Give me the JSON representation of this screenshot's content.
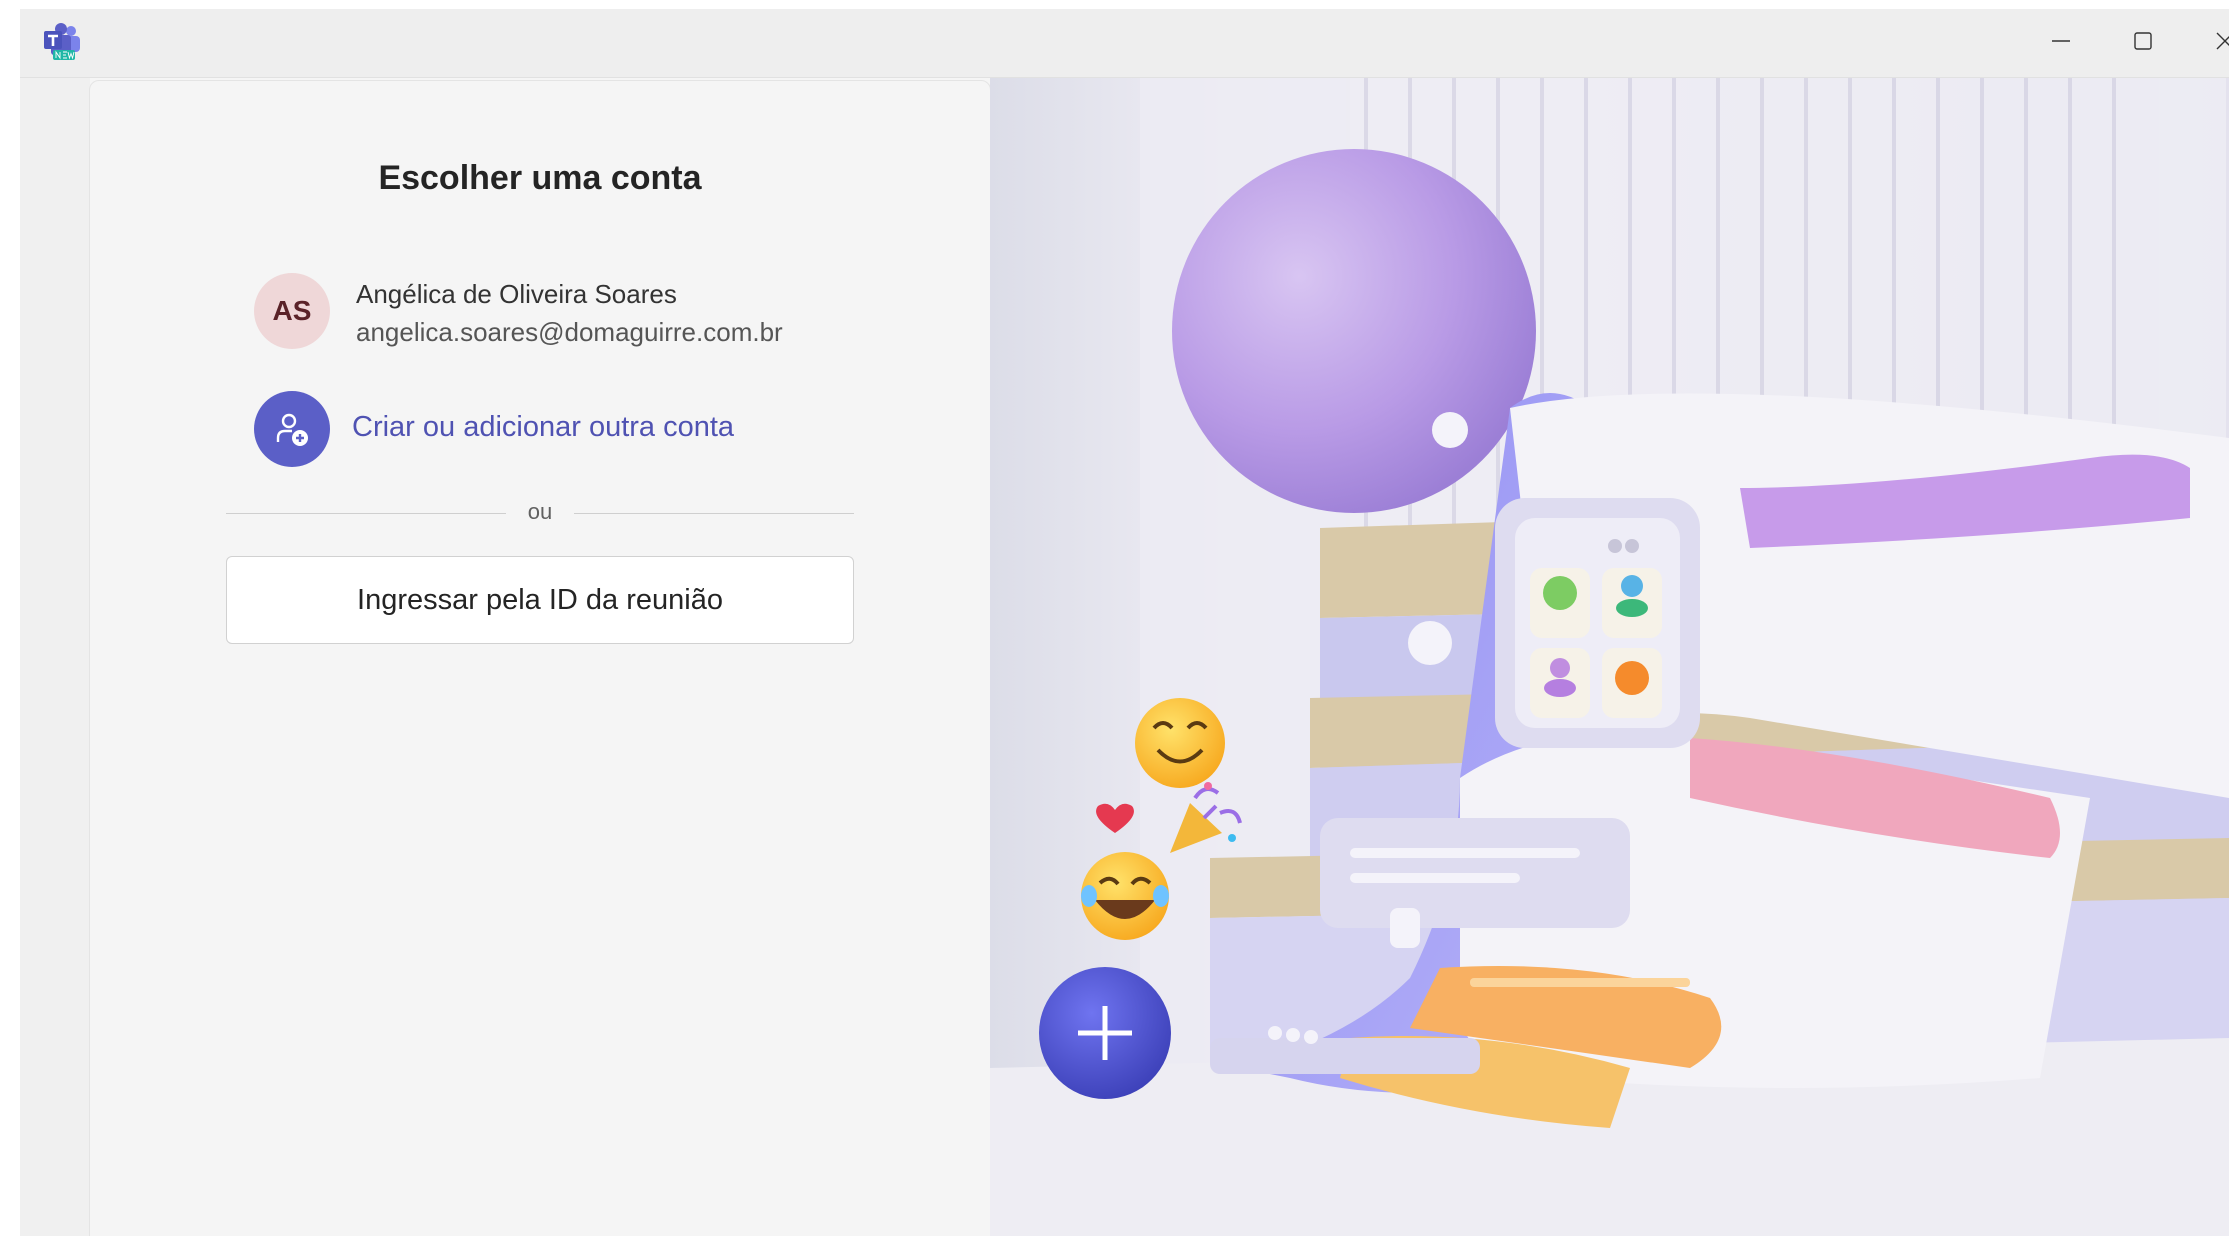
{
  "window": {
    "app_icon": "teams-new-icon",
    "controls": [
      "minimize-icon",
      "maximize-icon",
      "close-icon"
    ]
  },
  "card": {
    "title": "Escolher uma conta",
    "account": {
      "initials": "AS",
      "name": "Angélica de Oliveira Soares",
      "email": "angelica.soares@domaguirre.com.br"
    },
    "add_account": {
      "icon": "add-person-icon",
      "label": "Criar ou adicionar outra conta"
    },
    "divider_text": "ou",
    "join_button_label": "Ingressar pela ID da reunião"
  },
  "colors": {
    "brand": "#5b5fc7",
    "link": "#4f52b2",
    "avatar_bg": "#efd7d8",
    "avatar_text": "#5a2228"
  }
}
